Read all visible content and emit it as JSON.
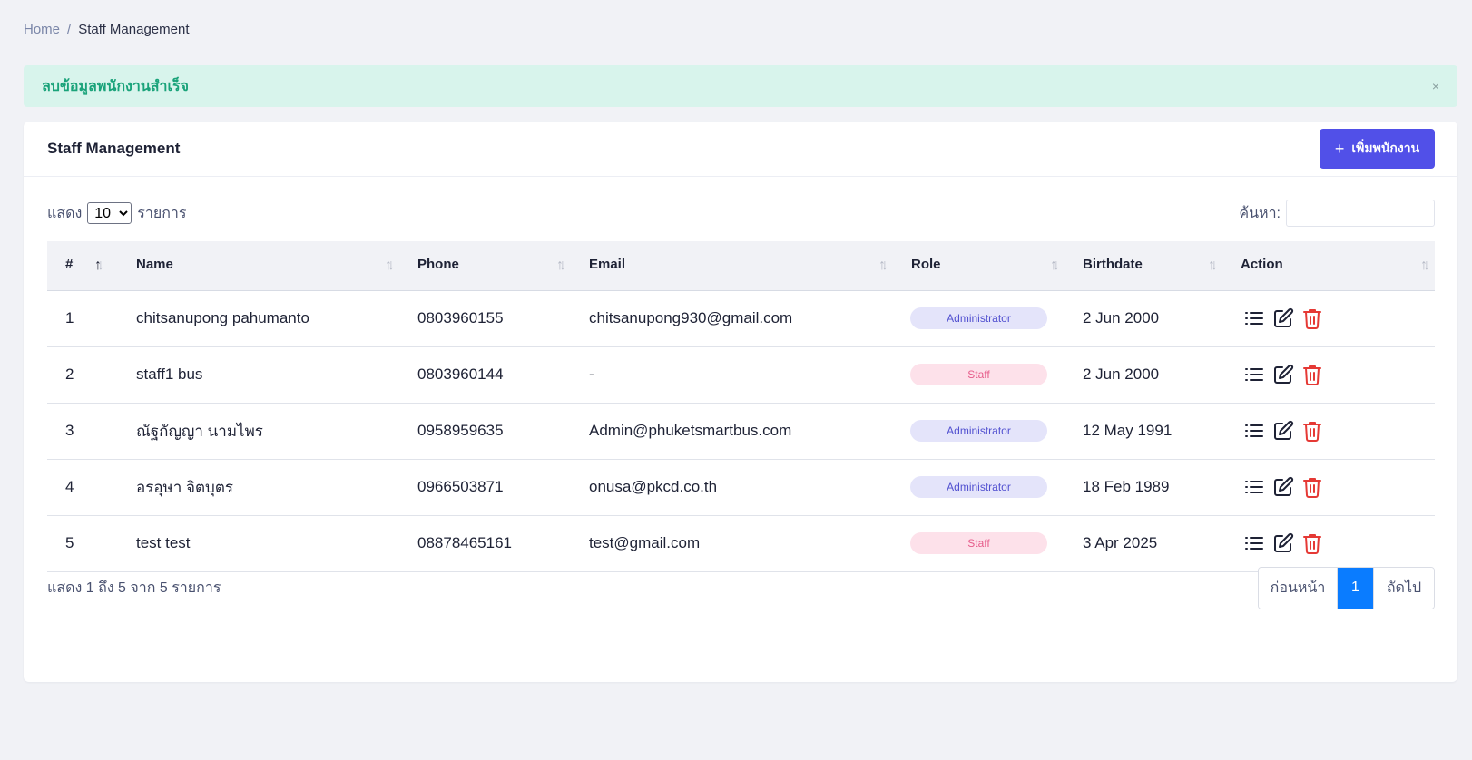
{
  "breadcrumb": {
    "home": "Home",
    "separator": "/",
    "current": "Staff Management"
  },
  "alert": {
    "message": "ลบข้อมูลพนักงานสำเร็จ",
    "close": "×"
  },
  "card": {
    "title": "Staff Management",
    "add_button": "เพิ่มพนักงาน",
    "add_icon": "plus-icon"
  },
  "length": {
    "prefix": "แสดง",
    "value": "10",
    "suffix": "รายการ",
    "options": [
      "10"
    ]
  },
  "search": {
    "label": "ค้นหา:",
    "value": ""
  },
  "table": {
    "columns": [
      "#",
      "Name",
      "Phone",
      "Email",
      "Role",
      "Birthdate",
      "Action"
    ],
    "rows": [
      {
        "num": "1",
        "name": "chitsanupong pahumanto",
        "phone": "0803960155",
        "email": "chitsanupong930@gmail.com",
        "role": "Administrator",
        "birthdate": "2 Jun 2000"
      },
      {
        "num": "2",
        "name": "staff1 bus",
        "phone": "0803960144",
        "email": "-",
        "role": "Staff",
        "birthdate": "2 Jun 2000"
      },
      {
        "num": "3",
        "name": "ณัฐกัญญา นามไพร",
        "phone": "0958959635",
        "email": "Admin@phuketsmartbus.com",
        "role": "Administrator",
        "birthdate": "12 May 1991"
      },
      {
        "num": "4",
        "name": "อรอุษา จิตบุตร",
        "phone": "0966503871",
        "email": "onusa@pkcd.co.th",
        "role": "Administrator",
        "birthdate": "18 Feb 1989"
      },
      {
        "num": "5",
        "name": "test test",
        "phone": "08878465161",
        "email": "test@gmail.com",
        "role": "Staff",
        "birthdate": "3 Apr 2025"
      }
    ]
  },
  "footer": {
    "info": "แสดง 1 ถึง 5 จาก 5 รายการ"
  },
  "pagination": {
    "prev": "ก่อนหน้า",
    "current": "1",
    "next": "ถัดไป"
  },
  "colors": {
    "primary": "#5150e8",
    "alert_bg": "#d8f4ec",
    "alert_text": "#1aa37a",
    "page_active": "#0a7cff",
    "delete": "#e53935"
  }
}
